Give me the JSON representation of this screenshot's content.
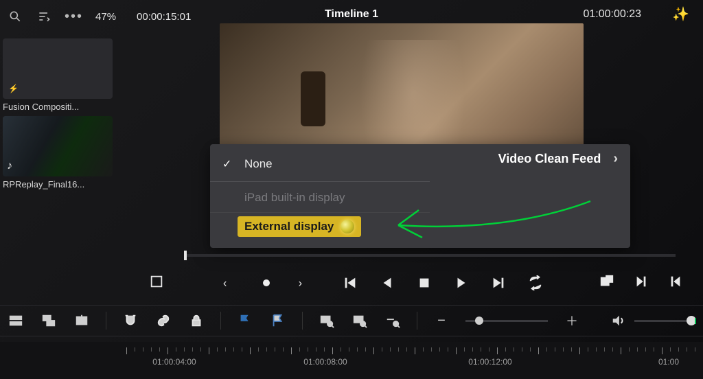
{
  "topbar": {
    "zoom": "47%",
    "source_timecode": "00:00:15:01",
    "timeline_title": "Timeline 1",
    "record_timecode": "01:00:00:23"
  },
  "bin": {
    "clips": [
      {
        "label": "Fusion Compositi..."
      },
      {
        "label": "RPReplay_Final16..."
      }
    ]
  },
  "menu": {
    "heading": "Video Clean Feed",
    "items": [
      {
        "label": "None",
        "checked": true,
        "enabled": true
      },
      {
        "label": "iPad built-in display",
        "checked": false,
        "enabled": false
      },
      {
        "label": "External display",
        "checked": false,
        "enabled": true,
        "highlighted": true
      }
    ]
  },
  "ruler": {
    "labels": [
      "01:00:04:00",
      "01:00:08:00",
      "01:00:12:00",
      "01:00"
    ]
  }
}
